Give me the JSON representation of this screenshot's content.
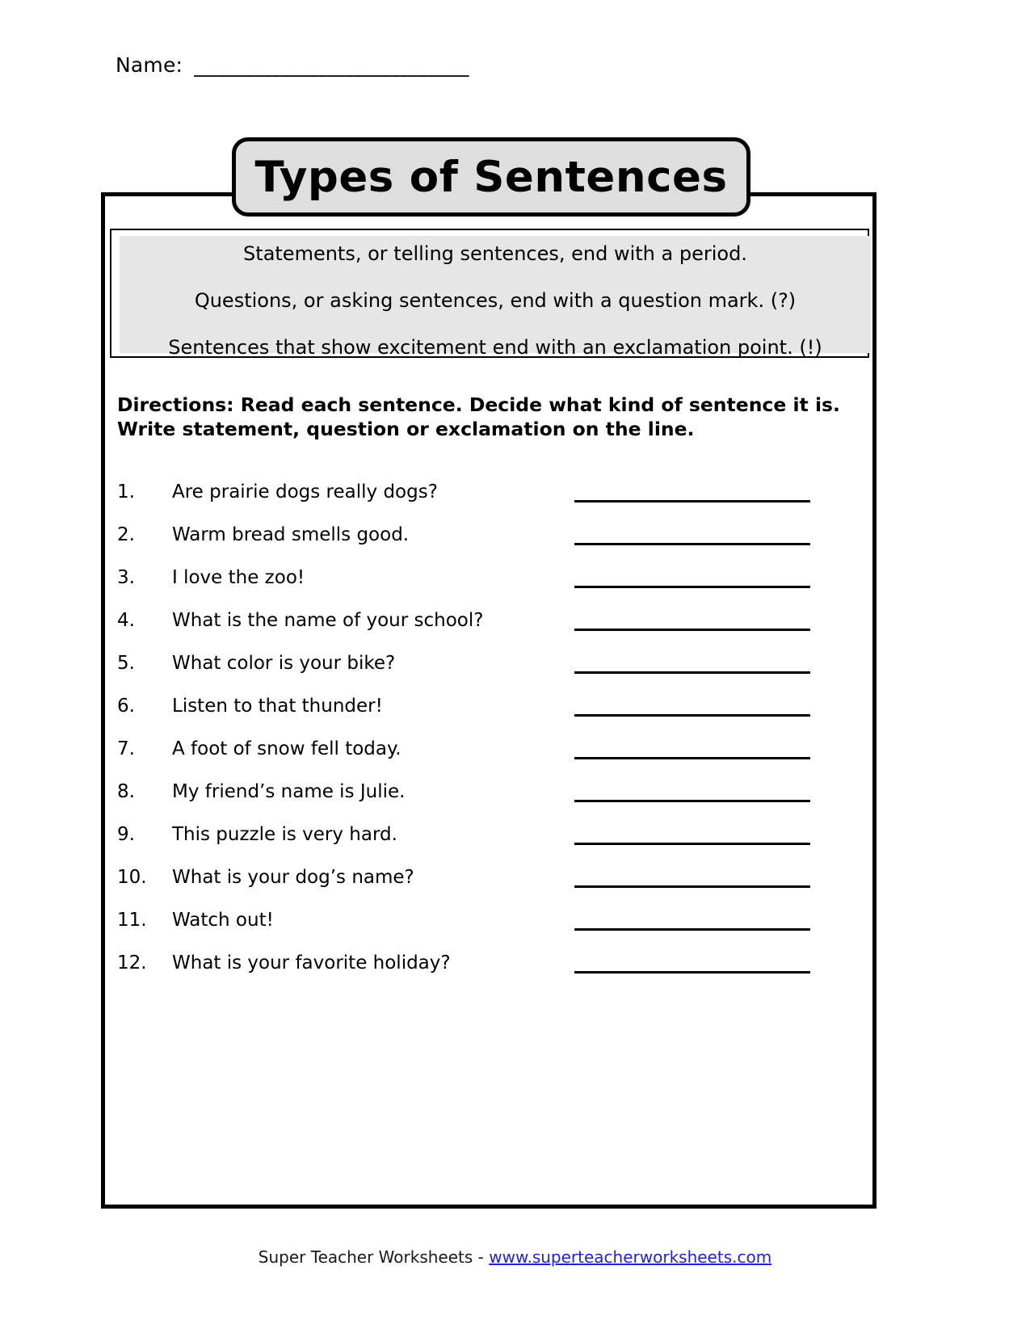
{
  "name_field": {
    "label": "Name:",
    "line": "______________________________"
  },
  "title": "Types of Sentences",
  "rules": [
    "Statements, or telling sentences, end with a period.",
    "Questions, or asking sentences, end with a question mark. (?)",
    "Sentences that show excitement end with an exclamation point. (!)"
  ],
  "directions": {
    "line1": "Directions:  Read each sentence.  Decide what kind of sentence it is.",
    "line2": "Write statement, question or exclamation on the line."
  },
  "items": [
    {
      "number": "1.",
      "sentence": "Are prairie dogs really dogs?"
    },
    {
      "number": "2.",
      "sentence": "Warm bread smells good."
    },
    {
      "number": "3.",
      "sentence": "I love the zoo!"
    },
    {
      "number": "4.",
      "sentence": "What is the name of your school?"
    },
    {
      "number": "5.",
      "sentence": "What color is your bike?"
    },
    {
      "number": "6.",
      "sentence": "Listen to that thunder!"
    },
    {
      "number": "7.",
      "sentence": "A foot of snow fell today."
    },
    {
      "number": "8.",
      "sentence": "My friend’s name is Julie."
    },
    {
      "number": "9.",
      "sentence": "This puzzle is very hard."
    },
    {
      "number": "10.",
      "sentence": "What is your dog’s name?"
    },
    {
      "number": "11.",
      "sentence": "Watch out!"
    },
    {
      "number": "12.",
      "sentence": "What is your favorite holiday?"
    }
  ],
  "footer": {
    "site_name": "Super Teacher Worksheets",
    "separator": "-",
    "url": "www.superteacherworksheets.com"
  },
  "colors": {
    "title_plaque_fill": "#dedede",
    "rules_fill": "#e6e6e6",
    "border": "#000000",
    "link": "#2222dd"
  }
}
